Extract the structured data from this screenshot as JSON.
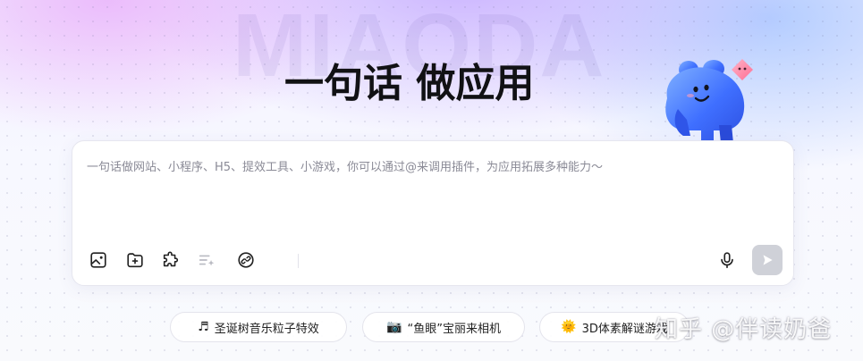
{
  "hero": {
    "watermark_text": "MIAODA",
    "title": "一句话 做应用"
  },
  "composer": {
    "placeholder": "一句话做网站、小程序、H5、提效工具、小游戏，你可以通过@来调用插件，为应用拓展多种能力～",
    "tools": [
      {
        "icon": "image-icon"
      },
      {
        "icon": "folder-add-icon"
      },
      {
        "icon": "plugin-icon"
      },
      {
        "icon": "magic-list-icon"
      },
      {
        "icon": "link-icon"
      }
    ],
    "mic_icon": "microphone-icon",
    "send_icon": "send-arrow-icon",
    "send_enabled": false
  },
  "suggestions": [
    {
      "icon": "♬",
      "label": "圣诞树音乐粒子特效"
    },
    {
      "icon": "📷",
      "label": "“鱼眼”宝丽来相机"
    },
    {
      "icon": "🌞",
      "label": "3D体素解谜游戏"
    }
  ],
  "watermark": {
    "text": "知乎 @伴读奶爸"
  },
  "colors": {
    "title": "#111114",
    "send_disabled": "#cfd1d8",
    "mascot_blue": "#3f7cff"
  }
}
